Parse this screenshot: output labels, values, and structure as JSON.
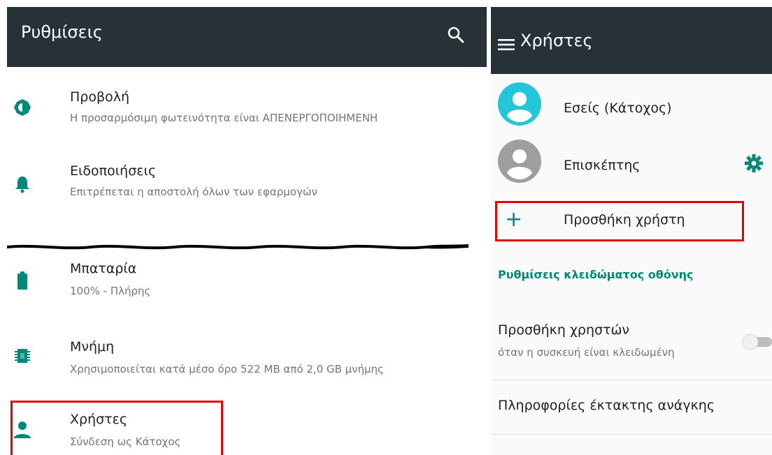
{
  "settings_screen": {
    "title": "Ρυθμίσεις",
    "items": [
      {
        "title": "Προβολή",
        "subtitle": "Η προσαρμόσιμη φωτεινότητα είναι ΑΠΕΝΕΡΓΟΠΟΙΗΜΕΝΗ",
        "icon": "brightness-icon"
      },
      {
        "title": "Ειδοποιήσεις",
        "subtitle": "Επιτρέπεται η αποστολή όλων των εφαρμογών",
        "icon": "bell-icon"
      },
      {
        "title": "Μπαταρία",
        "subtitle": "100% - Πλήρης",
        "icon": "battery-icon"
      },
      {
        "title": "Μνήμη",
        "subtitle": "Χρησιμοποιείται κατά μέσο όρο 522 MB από 2,0 GB μνήμης",
        "icon": "memory-icon"
      },
      {
        "title": "Χρήστες",
        "subtitle": "Σύνδεση ως Κάτοχος",
        "icon": "person-icon"
      }
    ]
  },
  "users_screen": {
    "title": "Χρήστες",
    "users": [
      {
        "name": "Εσείς (Κάτοχος)"
      },
      {
        "name": "Επισκέπτης"
      }
    ],
    "add_user_label": "Προσθήκη χρήστη",
    "lockscreen_section": "Ρυθμίσεις κλειδώματος οθόνης",
    "add_users_locked": {
      "title": "Προσθήκη χρηστών",
      "subtitle": "όταν η συσκευή είναι κλειδωμένη",
      "enabled": false
    },
    "emergency_info": "Πληροφορίες έκτακτης ανάγκης"
  },
  "colors": {
    "appbar": "#263238",
    "accent": "#00897b",
    "highlight": "#e60000"
  }
}
